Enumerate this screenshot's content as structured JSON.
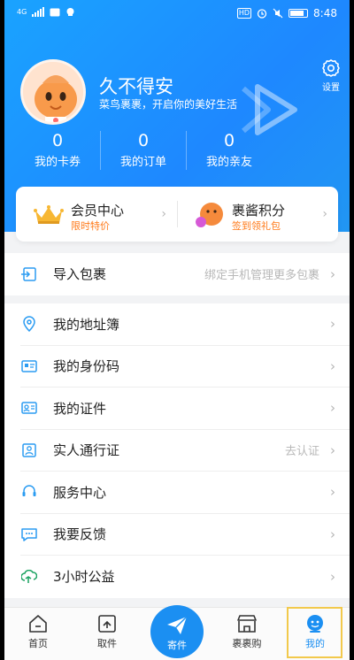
{
  "status_bar": {
    "time": "8:48",
    "net": "4G",
    "hd": "HD"
  },
  "profile": {
    "username": "久不得安",
    "slogan": "菜鸟裹裹，开启你的美好生活"
  },
  "settings": {
    "label": "设置",
    "icon": "gear-icon"
  },
  "stats": [
    {
      "value": "0",
      "label": "我的卡券"
    },
    {
      "value": "0",
      "label": "我的订单"
    },
    {
      "value": "0",
      "label": "我的亲友"
    }
  ],
  "member_card": {
    "left": {
      "title": "会员中心",
      "subtitle": "限时特价",
      "icon": "crown-icon"
    },
    "right": {
      "title": "裹酱积分",
      "subtitle": "签到领礼包",
      "icon": "mascot-icon"
    }
  },
  "import_row": {
    "label": "导入包裹",
    "hint": "绑定手机管理更多包裹",
    "icon": "import-icon"
  },
  "menu": [
    {
      "label": "我的地址簿",
      "hint": "",
      "icon": "location-icon"
    },
    {
      "label": "我的身份码",
      "hint": "",
      "icon": "id-code-icon"
    },
    {
      "label": "我的证件",
      "hint": "",
      "icon": "id-card-icon"
    },
    {
      "label": "实人通行证",
      "hint": "去认证",
      "icon": "person-badge-icon"
    },
    {
      "label": "服务中心",
      "hint": "",
      "icon": "headset-icon"
    },
    {
      "label": "我要反馈",
      "hint": "",
      "icon": "feedback-icon"
    },
    {
      "label": "3小时公益",
      "hint": "",
      "icon": "charity-icon"
    }
  ],
  "tabs": [
    {
      "label": "首页",
      "icon": "home-icon"
    },
    {
      "label": "取件",
      "icon": "pickup-icon"
    },
    {
      "label": "寄件",
      "icon": "send-icon"
    },
    {
      "label": "裹裹购",
      "icon": "shop-icon"
    },
    {
      "label": "我的",
      "icon": "profile-icon"
    }
  ],
  "colors": {
    "brand": "#1b8ff2",
    "accent": "#ff7a1a",
    "highlight": "#f2c94c"
  }
}
